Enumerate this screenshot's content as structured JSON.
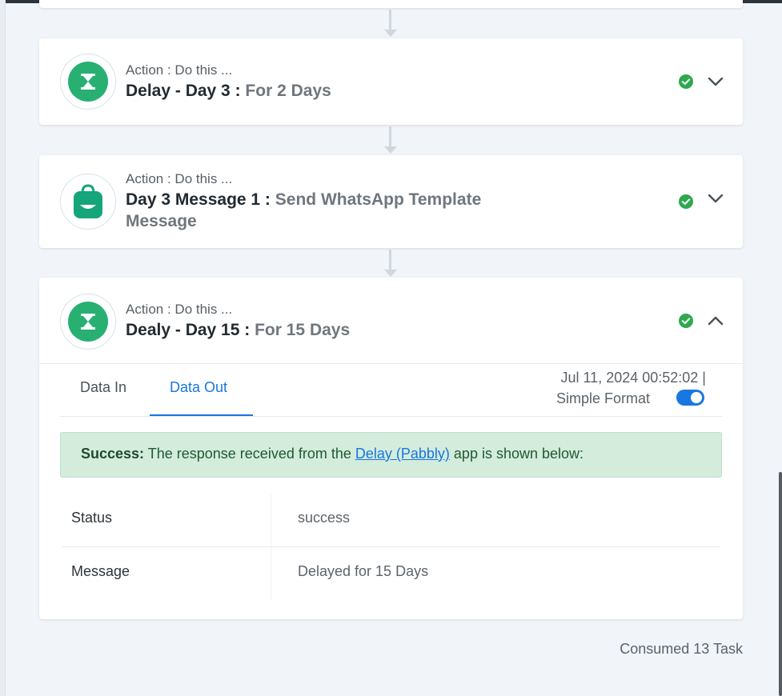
{
  "steps": [
    {
      "label": "Action : Do this ...",
      "name": "Delay - Day 3 :",
      "subtitle": "For 2 Days",
      "icon": "hourglass-icon"
    },
    {
      "label": "Action : Do this ...",
      "name": "Day 3 Message 1 :",
      "subtitle": "Send WhatsApp Template Message",
      "icon": "whatsapp-bag-icon"
    },
    {
      "label": "Action : Do this ...",
      "name": "Dealy - Day 15 :",
      "subtitle": "For 15 Days",
      "icon": "hourglass-icon"
    }
  ],
  "detail": {
    "tabs": [
      "Data In",
      "Data Out"
    ],
    "active_tab": "Data Out",
    "timestamp": "Jul 11, 2024 00:52:02  |",
    "format_label": "Simple Format",
    "format_enabled": true,
    "alert": {
      "prefix": "Success:",
      "text_before": " The response received from the ",
      "link": "Delay (Pabbly)",
      "text_after": " app is shown below:"
    },
    "rows": [
      {
        "key": "Status",
        "value": "success"
      },
      {
        "key": "Message",
        "value": "Delayed for 15 Days"
      }
    ]
  },
  "footer": {
    "consumed": "Consumed 13 Task"
  },
  "colors": {
    "accent": "#1877e0",
    "success_green": "#27b072",
    "alert_bg": "#d4ecdc"
  }
}
